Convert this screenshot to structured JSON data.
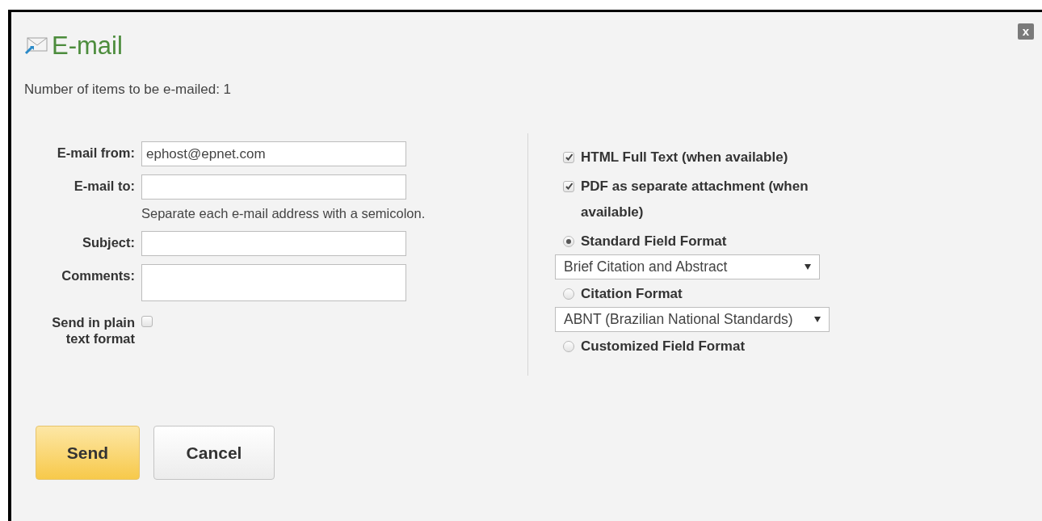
{
  "dialog": {
    "title": "E-mail",
    "close": "x"
  },
  "item_count": "Number of items to be e-mailed: 1",
  "fields": [
    {
      "kind": "input",
      "label": "E-mail from:",
      "value": "ephost@epnet.com"
    },
    {
      "kind": "input",
      "label": "E-mail to:",
      "note": "Separate each e-mail address with a semicolon."
    },
    {
      "kind": "input",
      "label": "Subject:"
    },
    {
      "kind": "textarea",
      "label": "Comments:"
    },
    {
      "kind": "checkbox",
      "label": "Send in plain text format",
      "checked": false
    }
  ],
  "options": [
    {
      "kind": "checkbox",
      "label": "HTML Full Text (when available)",
      "checked": true
    },
    {
      "kind": "checkbox",
      "label": "PDF as separate attachment (when available)",
      "checked": true
    },
    {
      "kind": "radio",
      "label": "Standard Field Format",
      "selected": true,
      "dropdown": "Brief Citation and Abstract"
    },
    {
      "kind": "radio",
      "label": "Citation Format",
      "selected": false,
      "dropdown": "ABNT (Brazilian National Standards)"
    },
    {
      "kind": "radio",
      "label": "Customized Field Format",
      "selected": false
    }
  ],
  "buttons": [
    {
      "kind": "primary",
      "label": "Send"
    },
    {
      "kind": "secondary",
      "label": "Cancel"
    }
  ]
}
